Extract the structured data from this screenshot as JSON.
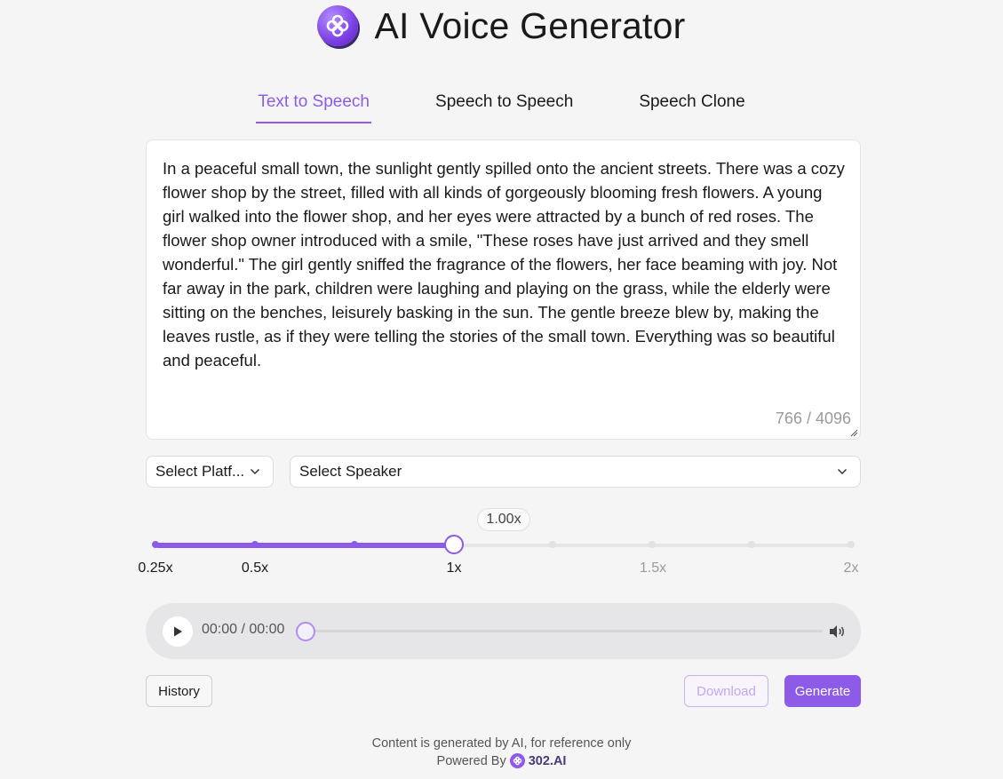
{
  "header": {
    "title": "AI Voice Generator",
    "logo_icon": "flower-logo-icon"
  },
  "tabs": [
    {
      "label": "Text to Speech",
      "active": true
    },
    {
      "label": "Speech to Speech",
      "active": false
    },
    {
      "label": "Speech Clone",
      "active": false
    }
  ],
  "editor": {
    "text": "In a peaceful small town, the sunlight gently spilled onto the ancient streets. There was a cozy flower shop by the street, filled with all kinds of gorgeously blooming fresh flowers. A young girl walked into the flower shop, and her eyes were attracted by a bunch of red roses. The flower shop owner introduced with a smile, \"These roses have just arrived and they smell wonderful.\" The girl gently sniffed the fragrance of the flowers, her face beaming with joy. Not far away in the park, children were laughing and playing on the grass, while the elderly were sitting on the benches, leisurely basking in the sun. The gentle breeze blew by, making the leaves rustle, as if they were telling the stories of the small town. Everything was so beautiful and peaceful.",
    "char_count": "766 / 4096"
  },
  "selects": {
    "platform": "Select Platf...",
    "speaker": "Select Speaker"
  },
  "speed": {
    "value_label": "1.00x",
    "value": 1.0,
    "marks": [
      "0.25x",
      "0.5x",
      "1x",
      "1.5x",
      "2x"
    ]
  },
  "player": {
    "time": "00:00 / 00:00",
    "progress": 0
  },
  "buttons": {
    "history": "History",
    "download": "Download",
    "generate": "Generate"
  },
  "footer": {
    "disclaimer": "Content is generated by AI, for reference only",
    "powered_by": "Powered By",
    "brand": "302.AI"
  },
  "colors": {
    "accent": "#8e5be8",
    "background": "#f5f5f5"
  }
}
